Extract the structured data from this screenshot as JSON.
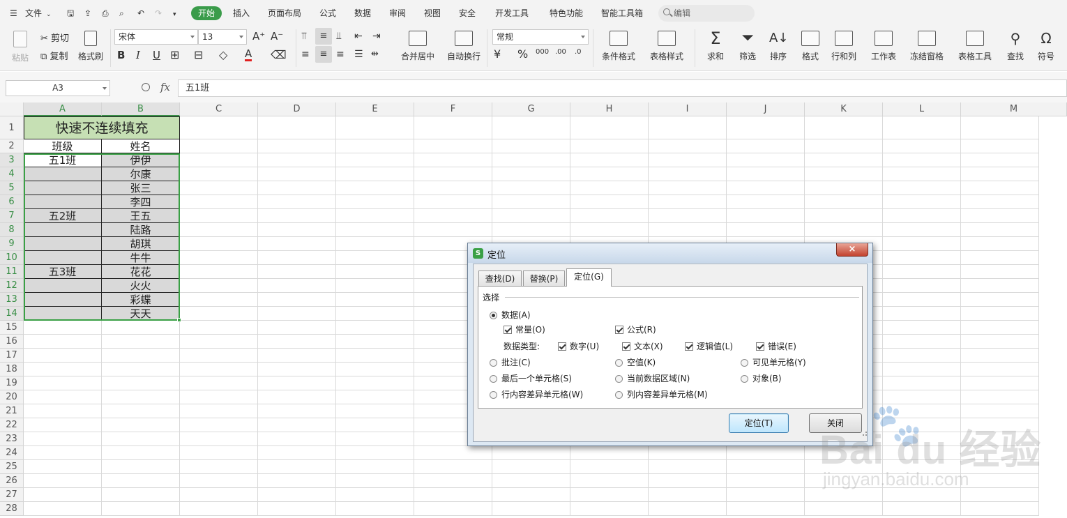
{
  "menu": {
    "items": [
      "文件",
      "开始",
      "插入",
      "页面布局",
      "公式",
      "数据",
      "审阅",
      "视图",
      "安全",
      "开发工具",
      "特色功能",
      "智能工具箱"
    ],
    "active": "开始",
    "search_placeholder": "编辑"
  },
  "ribbon": {
    "paste": "粘贴",
    "cut": "剪切",
    "copy": "复制",
    "format_painter": "格式刷",
    "font_name": "宋体",
    "font_size": "13",
    "number_format": "常规",
    "merge": "合并居中",
    "wrap": "自动换行",
    "cond_format": "条件格式",
    "table_style": "表格样式",
    "sum": "求和",
    "filter": "筛选",
    "sort": "排序",
    "format": "格式",
    "rowcol": "行和列",
    "sheet": "工作表",
    "freeze": "冻结窗格",
    "table_tools": "表格工具",
    "find": "查找",
    "symbol": "符号",
    "bold": "B",
    "italic": "I",
    "underline": "U",
    "percent": "%",
    "font_color": "A"
  },
  "formula_bar": {
    "name_box": "A3",
    "fx": "fx",
    "content": "五1班"
  },
  "sheet": {
    "columns": [
      "A",
      "B",
      "C",
      "D",
      "E",
      "F",
      "G",
      "H",
      "I",
      "J",
      "K",
      "L",
      "M"
    ],
    "rows": [
      "1",
      "2",
      "3",
      "4",
      "5",
      "6",
      "7",
      "8",
      "9",
      "10",
      "11",
      "12",
      "13",
      "14",
      "15",
      "16",
      "17",
      "18",
      "19",
      "20",
      "21",
      "22",
      "23",
      "24",
      "25",
      "26",
      "27",
      "28"
    ],
    "title": "快速不连续填充",
    "header_a": "班级",
    "header_b": "姓名",
    "col_a": [
      "五1班",
      "",
      "",
      "",
      "五2班",
      "",
      "",
      "",
      "五3班",
      "",
      "",
      ""
    ],
    "col_b": [
      "伊伊",
      "尔康",
      "张三",
      "李四",
      "王五",
      "陆路",
      "胡琪",
      "牛牛",
      "花花",
      "火火",
      "彩蝶",
      "天天"
    ],
    "colors": {
      "title_fill": "#c6e0b4",
      "selection_fill": "#d9d9d9",
      "selection_border": "#3aa045"
    }
  },
  "dialog": {
    "title": "定位",
    "close": "×",
    "tabs": [
      "查找(D)",
      "替换(P)",
      "定位(G)"
    ],
    "active_tab": "定位(G)",
    "group": "选择",
    "data": "数据(A)",
    "constants": "常量(O)",
    "formulas": "公式(R)",
    "datatype_label": "数据类型:",
    "numbers": "数字(U)",
    "text": "文本(X)",
    "logicals": "逻辑值(L)",
    "errors": "错误(E)",
    "comments": "批注(C)",
    "blanks": "空值(K)",
    "visible": "可见单元格(Y)",
    "last_cell": "最后一个单元格(S)",
    "current_region": "当前数据区域(N)",
    "objects": "对象(B)",
    "row_diff": "行内容差异单元格(W)",
    "col_diff": "列内容差异单元格(M)",
    "ok": "定位(T)",
    "cancel": "关闭"
  },
  "watermark": {
    "brand": "Bai du 经验",
    "url": "jingyan.baidu.com"
  }
}
